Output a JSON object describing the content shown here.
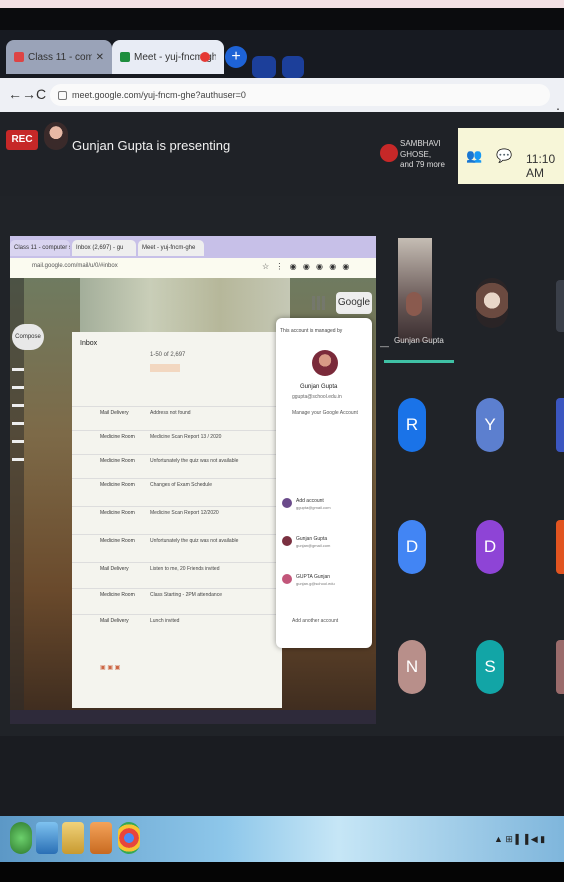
{
  "browser": {
    "tabs": [
      {
        "label": "Class 11 - computer sc..."
      },
      {
        "label": "Meet - yuj-fncm-ghe"
      }
    ],
    "new_tab": "+",
    "url": "meet.google.com/yuj-fncm-ghe?authuser=0",
    "nav": {
      "back": "←",
      "forward": "→",
      "reload": "C"
    },
    "menu": "⋮"
  },
  "meet": {
    "rec_label": "REC",
    "presenter_text": "Gunjan Gupta is presenting",
    "viewers_names": "SAMBHAVI GHOSE,",
    "viewers_more": "and 79 more",
    "people_icon": "👥",
    "chat_icon": "💬",
    "clock": "11:10 AM"
  },
  "shared_screen": {
    "tabs": [
      "Class 11 - computer sc",
      "Inbox (2,697) - gu",
      "Meet - yuj-fncm-ghe"
    ],
    "url": "mail.google.com/mail/u/0/#inbox",
    "toolbar_icons": "☆ ⋮ ◉ ◉ ◉ ◉ ◉",
    "google_button": "Google",
    "compose": "Compose",
    "email_header": "Inbox",
    "email_sub": "1-50 of 2,697",
    "emails": [
      {
        "sender": "Mail Delivery",
        "snippet": "Address not found"
      },
      {
        "sender": "Medicine Room",
        "snippet": "Medicine Scan Report 13 / 2020"
      },
      {
        "sender": "Medicine Room",
        "snippet": "Unfortunately the quiz was not available"
      },
      {
        "sender": "Medicine Room",
        "snippet": "Changes of Exam Schedule"
      },
      {
        "sender": "Medicine Room",
        "snippet": "Medicine Scan Report 12/2020"
      },
      {
        "sender": "Medicine Room",
        "snippet": "Unfortunately the quiz was not available"
      },
      {
        "sender": "Mail Delivery",
        "snippet": "Listen to me, 20 Friends invited"
      },
      {
        "sender": "Medicine Room",
        "snippet": "Class Starting - 2PM attendance"
      },
      {
        "sender": "Mail Delivery",
        "snippet": "Lunch invited"
      }
    ],
    "account_popup": {
      "top_line": "This account is managed by",
      "name": "Gunjan Gupta",
      "email": "ggupta@school.edu.in",
      "manage": "Manage your Google Account",
      "accounts": [
        {
          "name": "Add account",
          "mail": "ggupta@gmail.com",
          "color": "#6a4a8a"
        },
        {
          "name": "Gunjan Gupta",
          "mail": "gunjan@gmail.com",
          "color": "#7a3040"
        },
        {
          "name": "GUPTA Gunjan",
          "mail": "gunjan.g@school.edu",
          "color": "#c2567a"
        }
      ],
      "add_account": "Add another account"
    },
    "bottom_icons": "▣ ▣ ▣"
  },
  "participants": {
    "main_label": "Gunjan Gupta",
    "dash": "—",
    "avatars": [
      {
        "letter": "R",
        "color": "#1a73e8"
      },
      {
        "letter": "Y",
        "color": "#5c7fcf"
      },
      {
        "letter": "D",
        "color": "#4285f4"
      },
      {
        "letter": "D",
        "color": "#8e44d6"
      },
      {
        "letter": "N",
        "color": "#b88f8a"
      },
      {
        "letter": "S",
        "color": "#12a5a6"
      }
    ]
  },
  "taskbar": {
    "tray": "▲ ⊞ ▌▐ ◀ ▮"
  }
}
